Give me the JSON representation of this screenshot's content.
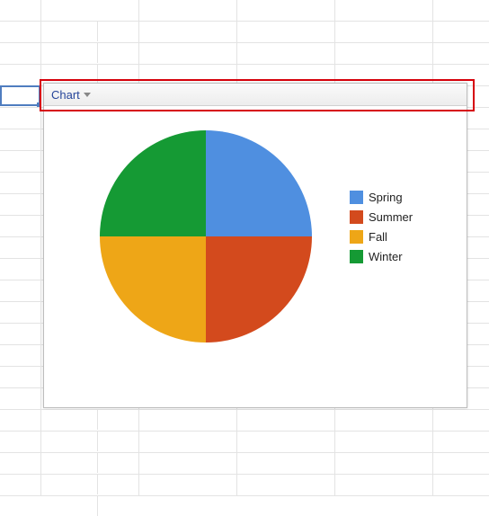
{
  "header": {
    "label": "Chart"
  },
  "legend": {
    "items": [
      {
        "name": "Spring",
        "color": "#4f8fe0"
      },
      {
        "name": "Summer",
        "color": "#d34a1d"
      },
      {
        "name": "Fall",
        "color": "#eea617"
      },
      {
        "name": "Winter",
        "color": "#159a34"
      }
    ]
  },
  "chart_data": {
    "type": "pie",
    "title": "",
    "categories": [
      "Spring",
      "Summer",
      "Fall",
      "Winter"
    ],
    "values": [
      25,
      25,
      25,
      25
    ],
    "colors": [
      "#4f8fe0",
      "#d34a1d",
      "#eea617",
      "#159a34"
    ]
  }
}
